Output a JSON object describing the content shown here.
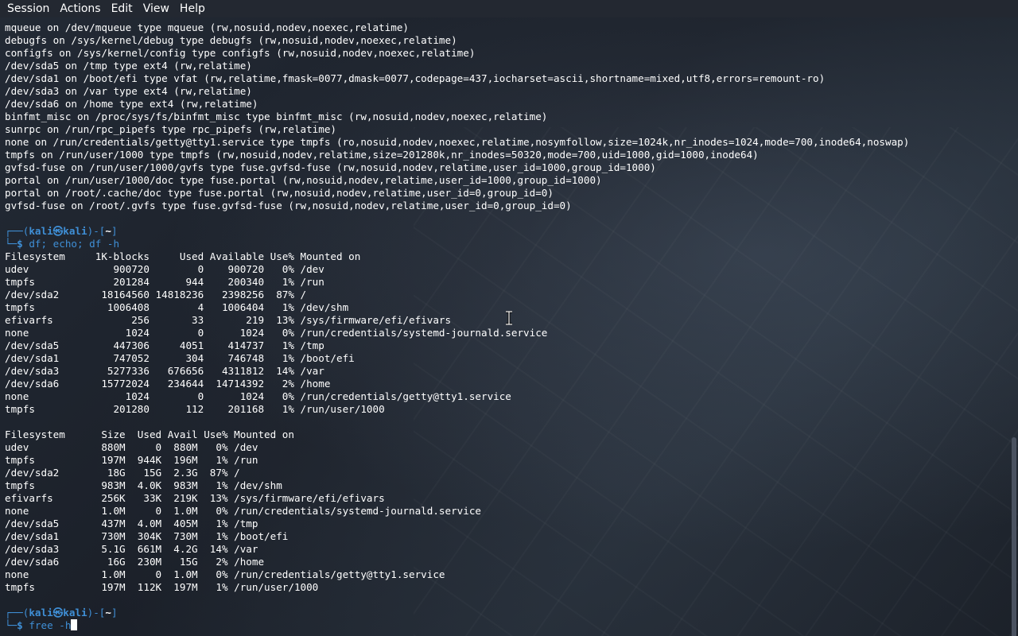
{
  "menubar": {
    "items": [
      "Session",
      "Actions",
      "Edit",
      "View",
      "Help"
    ]
  },
  "terminal": {
    "mount_lines": [
      "mqueue on /dev/mqueue type mqueue (rw,nosuid,nodev,noexec,relatime)",
      "debugfs on /sys/kernel/debug type debugfs (rw,nosuid,nodev,noexec,relatime)",
      "configfs on /sys/kernel/config type configfs (rw,nosuid,nodev,noexec,relatime)",
      "/dev/sda5 on /tmp type ext4 (rw,relatime)",
      "/dev/sda1 on /boot/efi type vfat (rw,relatime,fmask=0077,dmask=0077,codepage=437,iocharset=ascii,shortname=mixed,utf8,errors=remount-ro)",
      "/dev/sda3 on /var type ext4 (rw,relatime)",
      "/dev/sda6 on /home type ext4 (rw,relatime)",
      "binfmt_misc on /proc/sys/fs/binfmt_misc type binfmt_misc (rw,nosuid,nodev,noexec,relatime)",
      "sunrpc on /run/rpc_pipefs type rpc_pipefs (rw,relatime)",
      "none on /run/credentials/getty@tty1.service type tmpfs (ro,nosuid,nodev,noexec,relatime,nosymfollow,size=1024k,nr_inodes=1024,mode=700,inode64,noswap)",
      "tmpfs on /run/user/1000 type tmpfs (rw,nosuid,nodev,relatime,size=201280k,nr_inodes=50320,mode=700,uid=1000,gid=1000,inode64)",
      "gvfsd-fuse on /run/user/1000/gvfs type fuse.gvfsd-fuse (rw,nosuid,nodev,relatime,user_id=1000,group_id=1000)",
      "portal on /run/user/1000/doc type fuse.portal (rw,nosuid,nodev,relatime,user_id=1000,group_id=1000)",
      "portal on /root/.cache/doc type fuse.portal (rw,nosuid,nodev,relatime,user_id=0,group_id=0)",
      "gvfsd-fuse on /root/.gvfs type fuse.gvfsd-fuse (rw,nosuid,nodev,relatime,user_id=0,group_id=0)"
    ],
    "prompt": {
      "corner_top": "┌──(",
      "user_host": "kali㉿kali",
      "mid": ")-[",
      "cwd": "~",
      "end": "]",
      "corner_bottom": "└─",
      "dollar": "$ "
    },
    "command1": "df; echo; df -h",
    "df_lines": [
      "Filesystem     1K-blocks     Used Available Use% Mounted on",
      "udev              900720        0    900720   0% /dev",
      "tmpfs             201284      944    200340   1% /run",
      "/dev/sda2       18164560 14818236   2398256  87% /",
      "tmpfs            1006408        4   1006404   1% /dev/shm",
      "efivarfs             256       33       219  13% /sys/firmware/efi/efivars",
      "none                1024        0      1024   0% /run/credentials/systemd-journald.service",
      "/dev/sda5         447306     4051    414737   1% /tmp",
      "/dev/sda1         747052      304    746748   1% /boot/efi",
      "/dev/sda3        5277336   676656   4311812  14% /var",
      "/dev/sda6       15772024   234644  14714392   2% /home",
      "none                1024        0      1024   0% /run/credentials/getty@tty1.service",
      "tmpfs             201280      112    201168   1% /run/user/1000"
    ],
    "dfh_lines": [
      "Filesystem      Size  Used Avail Use% Mounted on",
      "udev            880M     0  880M   0% /dev",
      "tmpfs           197M  944K  196M   1% /run",
      "/dev/sda2        18G   15G  2.3G  87% /",
      "tmpfs           983M  4.0K  983M   1% /dev/shm",
      "efivarfs        256K   33K  219K  13% /sys/firmware/efi/efivars",
      "none            1.0M     0  1.0M   0% /run/credentials/systemd-journald.service",
      "/dev/sda5       437M  4.0M  405M   1% /tmp",
      "/dev/sda1       730M  304K  730M   1% /boot/efi",
      "/dev/sda3       5.1G  661M  4.2G  14% /var",
      "/dev/sda6        16G  230M   15G   2% /home",
      "none            1.0M     0  1.0M   0% /run/credentials/getty@tty1.service",
      "tmpfs           197M  112K  197M   1% /run/user/1000"
    ],
    "command2": "free -h"
  },
  "colors": {
    "prompt_blue": "#3f8fd6",
    "text": "#ffffff",
    "background": "#1c222c"
  }
}
